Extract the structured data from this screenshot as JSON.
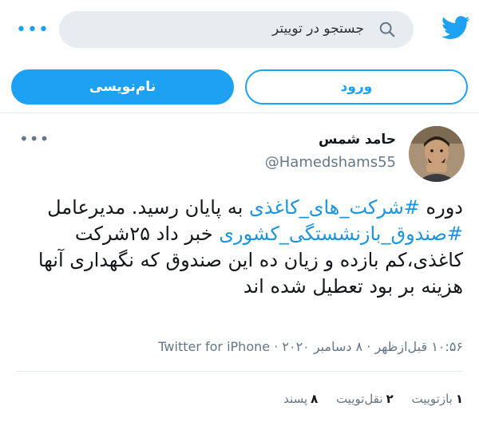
{
  "header": {
    "search_placeholder": "جستجو در توییتر",
    "icons": {
      "logo": "twitter-bird-icon",
      "search": "search-icon",
      "more": "more-dots-icon"
    }
  },
  "auth": {
    "signup_label": "نام‌نویسی",
    "login_label": "ورود"
  },
  "tweet": {
    "author_name": "حامد شمس",
    "author_handle": "@Hamedshams55",
    "text": {
      "part1": "دوره ",
      "hashtag1": "#شرکت_های_کاغذی",
      "part2": " به پایان رسید. مدیرعامل ",
      "hashtag2": "#صندوق_بازنشستگی_کشوری",
      "part3": " خبر داد ۲۵شرکت کاغذی،کم بازده و زیان ده این صندوق که نگهداری آنها هزینه بر بود تعطیل شده اند"
    },
    "time": "۱۰:۵۶ قبل‌ازظهر",
    "date": "۸ دسامبر ۲۰۲۰",
    "sep": "·",
    "source": "Twitter for iPhone",
    "stats": {
      "retweets_count": "۱",
      "retweets_label": "بازتوییت",
      "quotes_count": "۲",
      "quotes_label": "نقل‌توییت",
      "likes_count": "۸",
      "likes_label": "پسند"
    }
  },
  "colors": {
    "accent": "#1da1f2",
    "hashtag": "#1b95e0",
    "muted": "#657786",
    "search_bg": "#e6ecf0"
  }
}
